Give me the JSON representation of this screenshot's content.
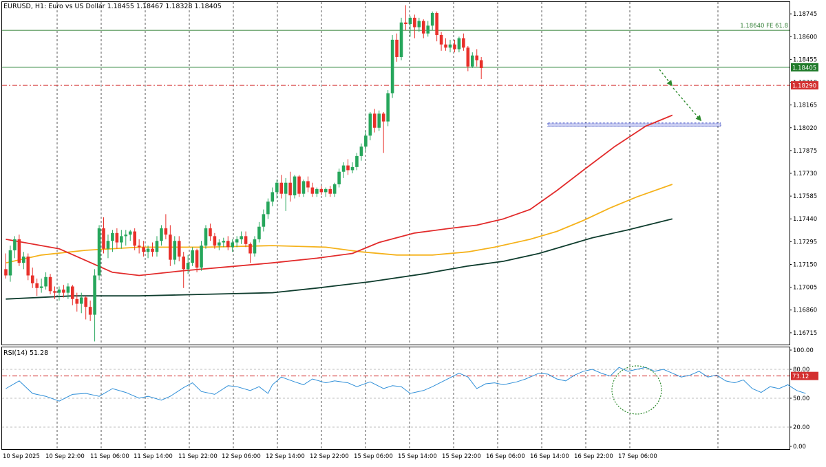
{
  "header": {
    "symbol_text": "EURUSD, H1:  Euro vs US Dollar  1.18455  1.18467  1.18328  1.18405"
  },
  "indicator": {
    "label": "RSI(14) 51.28"
  },
  "colors": {
    "bull": "#26a65b",
    "bear": "#e8302a",
    "ma_fast": "#e22b2b",
    "ma_mid": "#f5b21b",
    "ma_slow": "#0f3d2e",
    "rsi": "#2f8fd8",
    "fib": "#2f7d32",
    "price_line": "#1f7a2a",
    "resistance": "#d32f2f",
    "support_zone": "#2b3dbd",
    "arrow": "#2e8b2e",
    "grid": "#555555"
  },
  "chart_data": {
    "type": "candlestick",
    "yaxis_ticks": [
      "1.18745",
      "1.18600",
      "1.18455",
      "1.18310",
      "1.18165",
      "1.18020",
      "1.17875",
      "1.17730",
      "1.17585",
      "1.17440",
      "1.17295",
      "1.17150",
      "1.17005",
      "1.16860",
      "1.16715"
    ],
    "xaxis_ticks": [
      "10 Sep 2025",
      "10 Sep 22:00",
      "11 Sep 06:00",
      "11 Sep 14:00",
      "11 Sep 22:00",
      "12 Sep 06:00",
      "12 Sep 14:00",
      "12 Sep 22:00",
      "15 Sep 06:00",
      "15 Sep 14:00",
      "15 Sep 22:00",
      "16 Sep 06:00",
      "16 Sep 14:00",
      "16 Sep 22:00",
      "17 Sep 06:00"
    ],
    "ylim": [
      1.1664,
      1.1882
    ],
    "levels": {
      "fib": {
        "price": 1.1864,
        "label": "1.18640 FE 61.8",
        "tag": ""
      },
      "current": {
        "price": 1.18405,
        "tag": "1.18405"
      },
      "resistance": {
        "price": 1.1829,
        "tag": "1.18290"
      },
      "support_zone": {
        "low": 1.1803,
        "high": 1.1805
      }
    },
    "candles": [
      [
        1.1712,
        1.1722,
        1.1706,
        1.1708
      ],
      [
        1.1708,
        1.1727,
        1.1704,
        1.1724
      ],
      [
        1.1724,
        1.1733,
        1.1719,
        1.1731
      ],
      [
        1.1731,
        1.1734,
        1.1714,
        1.1716
      ],
      [
        1.1716,
        1.1723,
        1.1712,
        1.172
      ],
      [
        1.172,
        1.1722,
        1.1705,
        1.1708
      ],
      [
        1.1708,
        1.1713,
        1.17,
        1.1703
      ],
      [
        1.1703,
        1.1706,
        1.1695,
        1.17
      ],
      [
        1.17,
        1.1706,
        1.1697,
        1.1701
      ],
      [
        1.1701,
        1.171,
        1.1699,
        1.1707
      ],
      [
        1.1707,
        1.1709,
        1.1696,
        1.1698
      ],
      [
        1.1698,
        1.1701,
        1.1693,
        1.1697
      ],
      [
        1.1697,
        1.1701,
        1.1692,
        1.1699
      ],
      [
        1.1699,
        1.1702,
        1.1694,
        1.1697
      ],
      [
        1.1697,
        1.1703,
        1.1693,
        1.1701
      ],
      [
        1.1701,
        1.1702,
        1.1689,
        1.1693
      ],
      [
        1.1693,
        1.1697,
        1.1685,
        1.169
      ],
      [
        1.169,
        1.1697,
        1.1684,
        1.1694
      ],
      [
        1.1694,
        1.1695,
        1.168,
        1.1688
      ],
      [
        1.1688,
        1.1692,
        1.1679,
        1.1683
      ],
      [
        1.1683,
        1.1712,
        1.1666,
        1.1708
      ],
      [
        1.1708,
        1.174,
        1.1705,
        1.1738
      ],
      [
        1.1738,
        1.1745,
        1.1722,
        1.1725
      ],
      [
        1.1725,
        1.1734,
        1.1719,
        1.173
      ],
      [
        1.173,
        1.1737,
        1.1723,
        1.1735
      ],
      [
        1.1735,
        1.1738,
        1.1725,
        1.1729
      ],
      [
        1.1729,
        1.1737,
        1.1725,
        1.1733
      ],
      [
        1.1733,
        1.1737,
        1.1727,
        1.1734
      ],
      [
        1.1734,
        1.1737,
        1.173,
        1.1736
      ],
      [
        1.1736,
        1.1738,
        1.1724,
        1.1727
      ],
      [
        1.1727,
        1.1731,
        1.1722,
        1.1726
      ],
      [
        1.1726,
        1.173,
        1.172,
        1.1723
      ],
      [
        1.1723,
        1.1727,
        1.1719,
        1.1725
      ],
      [
        1.1725,
        1.1729,
        1.172,
        1.1723
      ],
      [
        1.1723,
        1.1733,
        1.172,
        1.173
      ],
      [
        1.173,
        1.174,
        1.1727,
        1.1738
      ],
      [
        1.1738,
        1.1747,
        1.1731,
        1.1734
      ],
      [
        1.1734,
        1.174,
        1.1714,
        1.1718
      ],
      [
        1.1718,
        1.1733,
        1.1715,
        1.173
      ],
      [
        1.173,
        1.1733,
        1.1717,
        1.172
      ],
      [
        1.172,
        1.1723,
        1.17,
        1.1712
      ],
      [
        1.1712,
        1.1721,
        1.1709,
        1.1716
      ],
      [
        1.1716,
        1.1726,
        1.1714,
        1.1724
      ],
      [
        1.1724,
        1.1725,
        1.171,
        1.1713
      ],
      [
        1.1713,
        1.173,
        1.1711,
        1.1727
      ],
      [
        1.1727,
        1.174,
        1.1725,
        1.1738
      ],
      [
        1.1738,
        1.1741,
        1.173,
        1.1733
      ],
      [
        1.1733,
        1.1735,
        1.1725,
        1.1727
      ],
      [
        1.1727,
        1.1731,
        1.1724,
        1.1729
      ],
      [
        1.1729,
        1.1732,
        1.1726,
        1.173
      ],
      [
        1.173,
        1.1733,
        1.1724,
        1.1726
      ],
      [
        1.1726,
        1.1731,
        1.1723,
        1.1729
      ],
      [
        1.1729,
        1.1733,
        1.1726,
        1.1731
      ],
      [
        1.1731,
        1.1736,
        1.1728,
        1.1733
      ],
      [
        1.1733,
        1.1736,
        1.1726,
        1.1728
      ],
      [
        1.1728,
        1.1729,
        1.1716,
        1.1722
      ],
      [
        1.1722,
        1.1733,
        1.172,
        1.1731
      ],
      [
        1.1731,
        1.1742,
        1.1729,
        1.1739
      ],
      [
        1.1739,
        1.175,
        1.1736,
        1.1747
      ],
      [
        1.1747,
        1.1757,
        1.1744,
        1.1755
      ],
      [
        1.1755,
        1.1764,
        1.1752,
        1.1761
      ],
      [
        1.1761,
        1.1769,
        1.1757,
        1.1767
      ],
      [
        1.1767,
        1.1772,
        1.1757,
        1.176
      ],
      [
        1.176,
        1.177,
        1.1749,
        1.1767
      ],
      [
        1.1767,
        1.1774,
        1.1755,
        1.1759
      ],
      [
        1.1759,
        1.1772,
        1.1757,
        1.1771
      ],
      [
        1.1771,
        1.1772,
        1.1758,
        1.176
      ],
      [
        1.176,
        1.1769,
        1.1758,
        1.1768
      ],
      [
        1.1768,
        1.1771,
        1.1761,
        1.1764
      ],
      [
        1.1764,
        1.1767,
        1.1758,
        1.176
      ],
      [
        1.176,
        1.1764,
        1.1758,
        1.1763
      ],
      [
        1.1763,
        1.1765,
        1.1759,
        1.1761
      ],
      [
        1.1761,
        1.1764,
        1.1758,
        1.1763
      ],
      [
        1.1763,
        1.1765,
        1.1758,
        1.176
      ],
      [
        1.176,
        1.1767,
        1.1758,
        1.1766
      ],
      [
        1.1766,
        1.1776,
        1.1764,
        1.1774
      ],
      [
        1.1774,
        1.178,
        1.177,
        1.1778
      ],
      [
        1.1778,
        1.1782,
        1.1772,
        1.1775
      ],
      [
        1.1775,
        1.178,
        1.1773,
        1.1777
      ],
      [
        1.1777,
        1.1786,
        1.1775,
        1.1784
      ],
      [
        1.1784,
        1.1792,
        1.1781,
        1.179
      ],
      [
        1.179,
        1.18,
        1.1787,
        1.1797
      ],
      [
        1.1797,
        1.1812,
        1.1794,
        1.1811
      ],
      [
        1.1811,
        1.1814,
        1.1799,
        1.1802
      ],
      [
        1.1802,
        1.1813,
        1.18,
        1.1811
      ],
      [
        1.1811,
        1.1812,
        1.1786,
        1.1806
      ],
      [
        1.1806,
        1.1826,
        1.1803,
        1.1824
      ],
      [
        1.1824,
        1.1861,
        1.1821,
        1.1858
      ],
      [
        1.1858,
        1.1862,
        1.1844,
        1.1847
      ],
      [
        1.1847,
        1.1872,
        1.1845,
        1.1869
      ],
      [
        1.1869,
        1.188,
        1.1864,
        1.1868
      ],
      [
        1.1868,
        1.1873,
        1.186,
        1.1872
      ],
      [
        1.1872,
        1.1874,
        1.1859,
        1.1866
      ],
      [
        1.1866,
        1.1872,
        1.1863,
        1.187
      ],
      [
        1.187,
        1.1871,
        1.1859,
        1.1862
      ],
      [
        1.1862,
        1.187,
        1.186,
        1.1867
      ],
      [
        1.1867,
        1.1876,
        1.1864,
        1.1875
      ],
      [
        1.1875,
        1.1876,
        1.1857,
        1.1861
      ],
      [
        1.1861,
        1.1863,
        1.1851,
        1.1855
      ],
      [
        1.1855,
        1.1859,
        1.1851,
        1.1853
      ],
      [
        1.1853,
        1.1858,
        1.185,
        1.1855
      ],
      [
        1.1855,
        1.1858,
        1.185,
        1.1852
      ],
      [
        1.1852,
        1.186,
        1.185,
        1.1859
      ],
      [
        1.1859,
        1.1862,
        1.1851,
        1.1853
      ],
      [
        1.1853,
        1.1854,
        1.1838,
        1.1841
      ],
      [
        1.1841,
        1.185,
        1.184,
        1.1848
      ],
      [
        1.1848,
        1.1852,
        1.1841,
        1.1845
      ],
      [
        1.1845,
        1.1847,
        1.1833,
        1.184
      ]
    ],
    "ma_fast": [
      [
        0,
        1.1731
      ],
      [
        12,
        1.1725
      ],
      [
        24,
        1.171
      ],
      [
        30,
        1.1708
      ],
      [
        40,
        1.1711
      ],
      [
        52,
        1.1714
      ],
      [
        60,
        1.1716
      ],
      [
        70,
        1.1719
      ],
      [
        78,
        1.1722
      ],
      [
        84,
        1.1729
      ],
      [
        92,
        1.1735
      ],
      [
        100,
        1.1738
      ],
      [
        106,
        1.174
      ],
      [
        112,
        1.1744
      ],
      [
        118,
        1.175
      ],
      [
        124,
        1.1762
      ],
      [
        130,
        1.1775
      ],
      [
        137,
        1.179
      ],
      [
        144,
        1.1803
      ],
      [
        150,
        1.181
      ]
    ],
    "ma_mid": [
      [
        0,
        1.1716
      ],
      [
        8,
        1.1721
      ],
      [
        18,
        1.1724
      ],
      [
        30,
        1.1726
      ],
      [
        45,
        1.1726
      ],
      [
        60,
        1.1727
      ],
      [
        72,
        1.1726
      ],
      [
        80,
        1.1723
      ],
      [
        88,
        1.1721
      ],
      [
        96,
        1.1721
      ],
      [
        104,
        1.1723
      ],
      [
        110,
        1.1726
      ],
      [
        118,
        1.1731
      ],
      [
        124,
        1.1736
      ],
      [
        130,
        1.1743
      ],
      [
        136,
        1.1751
      ],
      [
        142,
        1.1758
      ],
      [
        150,
        1.1766
      ]
    ],
    "ma_slow": [
      [
        0,
        1.1693
      ],
      [
        15,
        1.1695
      ],
      [
        30,
        1.1695
      ],
      [
        45,
        1.1696
      ],
      [
        60,
        1.1697
      ],
      [
        70,
        1.17
      ],
      [
        82,
        1.1704
      ],
      [
        94,
        1.1709
      ],
      [
        104,
        1.1714
      ],
      [
        112,
        1.1717
      ],
      [
        120,
        1.1722
      ],
      [
        126,
        1.1727
      ],
      [
        132,
        1.1732
      ],
      [
        140,
        1.1737
      ],
      [
        150,
        1.1744
      ]
    ],
    "rsi": {
      "ylim": [
        0,
        100
      ],
      "ticks": [
        "100.00",
        "80.00",
        "50.00",
        "20.00",
        "0.00"
      ],
      "level": {
        "value": 73.12,
        "tag": "73.12"
      },
      "values": [
        [
          0,
          60
        ],
        [
          3,
          68
        ],
        [
          6,
          55
        ],
        [
          9,
          52
        ],
        [
          12,
          47
        ],
        [
          15,
          54
        ],
        [
          18,
          55
        ],
        [
          21,
          52
        ],
        [
          24,
          60
        ],
        [
          27,
          56
        ],
        [
          30,
          50
        ],
        [
          32,
          52
        ],
        [
          35,
          48
        ],
        [
          37,
          52
        ],
        [
          40,
          61
        ],
        [
          42,
          66
        ],
        [
          44,
          57
        ],
        [
          47,
          54
        ],
        [
          50,
          63
        ],
        [
          52,
          62
        ],
        [
          55,
          58
        ],
        [
          57,
          62
        ],
        [
          59,
          55
        ],
        [
          60,
          64
        ],
        [
          62,
          72
        ],
        [
          65,
          67
        ],
        [
          67,
          64
        ],
        [
          69,
          70
        ],
        [
          72,
          66
        ],
        [
          74,
          68
        ],
        [
          77,
          66
        ],
        [
          79,
          62
        ],
        [
          82,
          67
        ],
        [
          85,
          60
        ],
        [
          87,
          63
        ],
        [
          89,
          62
        ],
        [
          91,
          55
        ],
        [
          94,
          58
        ],
        [
          96,
          62
        ],
        [
          99,
          69
        ],
        [
          102,
          76
        ],
        [
          104,
          72
        ],
        [
          106,
          60
        ],
        [
          108,
          65
        ],
        [
          110,
          66
        ],
        [
          112,
          64
        ],
        [
          115,
          67
        ],
        [
          117,
          70
        ],
        [
          120,
          76
        ],
        [
          122,
          75
        ],
        [
          124,
          70
        ],
        [
          126,
          68
        ],
        [
          128,
          74
        ],
        [
          130,
          78
        ],
        [
          132,
          80
        ],
        [
          134,
          76
        ],
        [
          136,
          73
        ],
        [
          138,
          82
        ],
        [
          140,
          78
        ],
        [
          142,
          80
        ],
        [
          144,
          82
        ],
        [
          146,
          78
        ],
        [
          148,
          80
        ],
        [
          150,
          76
        ],
        [
          152,
          72
        ],
        [
          154,
          74
        ],
        [
          156,
          78
        ],
        [
          158,
          72
        ],
        [
          160,
          74
        ],
        [
          162,
          68
        ],
        [
          164,
          66
        ],
        [
          166,
          69
        ],
        [
          168,
          60
        ],
        [
          170,
          56
        ],
        [
          172,
          62
        ],
        [
          174,
          60
        ],
        [
          176,
          64
        ],
        [
          178,
          58
        ],
        [
          180,
          55
        ]
      ]
    }
  }
}
